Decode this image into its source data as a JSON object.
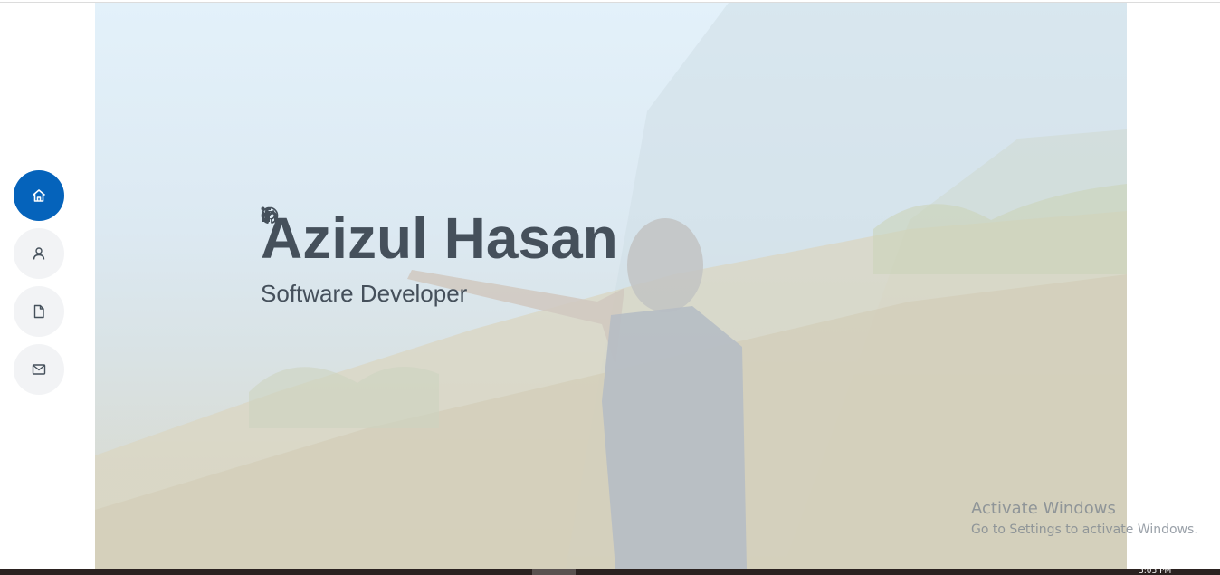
{
  "hero": {
    "name": "Azizul Hasan",
    "subtitle": "Software Developer",
    "social": [
      {
        "icon": "facebook-icon",
        "glyph": "f"
      },
      {
        "icon": "linkedin-icon",
        "glyph": "in"
      },
      {
        "icon": "github-icon",
        "glyph": ""
      },
      {
        "icon": "facebook-icon",
        "glyph": "f"
      }
    ]
  },
  "nav": {
    "items": [
      {
        "icon": "home-icon",
        "active": true
      },
      {
        "icon": "person-icon",
        "active": false
      },
      {
        "icon": "file-icon",
        "active": false
      },
      {
        "icon": "envelope-icon",
        "active": false
      }
    ]
  },
  "watermark": {
    "title": "Activate Windows",
    "subtitle": "Go to Settings to activate Windows."
  },
  "taskbar": {
    "clock": "3:03 PM"
  },
  "colors": {
    "accent": "#0563bb",
    "text": "#45505b",
    "nav_bg": "#f2f3f5"
  }
}
